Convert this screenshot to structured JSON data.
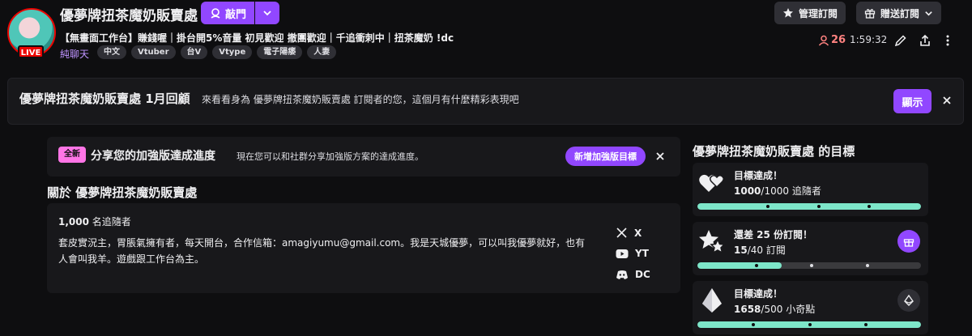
{
  "header": {
    "channel_name": "優夢牌扭茶魔奶販賣處",
    "live_label": "LIVE",
    "follow_label": "敲門",
    "stream_title": "【無畫面工作台】賺錢喔｜掛台開5%音量 初見歡迎 撤團歡迎｜千追衝刺中｜扭茶魔奶 !dc",
    "category": "純聊天",
    "tags": [
      "中文",
      "Vtuber",
      "台V",
      "Vtype",
      "電子陽痿",
      "人妻"
    ],
    "manage_sub_label": "管理訂閱",
    "gift_sub_label": "贈送訂閱",
    "viewer_count": "26",
    "uptime": "1:59:32"
  },
  "recap_banner": {
    "title": "優夢牌扭茶魔奶販賣處 1月回顧",
    "subtitle": "來看看身為 優夢牌扭茶魔奶販賣處 訂閱者的您，這個月有什麼精彩表現吧",
    "show_label": "顯示"
  },
  "share_card": {
    "new_badge": "全新",
    "title": "分享您的加強版達成進度",
    "subtitle": "現在您可以和社群分享加強版方案的達成進度。",
    "add_goal_label": "新增加強版目標"
  },
  "about": {
    "heading": "關於 優夢牌扭茶魔奶販賣處",
    "followers_count": "1,000",
    "followers_label": "名追隨者",
    "bio": "套皮實況主，胃脹氣擁有者，每天開台，合作信箱：amagiyumu@gmail.com。我是天城優夢，可以叫我優夢就好，也有人會叫我羊。遊戲跟工作台為主。",
    "socials": [
      {
        "icon": "x-icon",
        "label": "X"
      },
      {
        "icon": "youtube-icon",
        "label": "YT"
      },
      {
        "icon": "discord-icon",
        "label": "DC"
      }
    ]
  },
  "goals": {
    "heading": "優夢牌扭茶魔奶販賣處 的目標",
    "items": [
      {
        "icon": "hearts-icon",
        "title": "目標達成！",
        "current": "1000",
        "target": "/1000",
        "unit": "追隨者",
        "progress": 1.0
      },
      {
        "icon": "stars-icon",
        "title": "還差 25 份訂閱！",
        "current": "15",
        "target": "/40",
        "unit": "訂閱",
        "progress": 0.375
      },
      {
        "icon": "diamond-icon",
        "title": "目標達成！",
        "current": "1658",
        "target": "/500",
        "unit": "小奇點",
        "progress": 1.0
      }
    ]
  },
  "colors": {
    "accent": "#9147ff",
    "live": "#eb0400",
    "goal_fill": "#7de6c9",
    "viewer": "#ff8280",
    "new_badge": "#ff75e6"
  }
}
